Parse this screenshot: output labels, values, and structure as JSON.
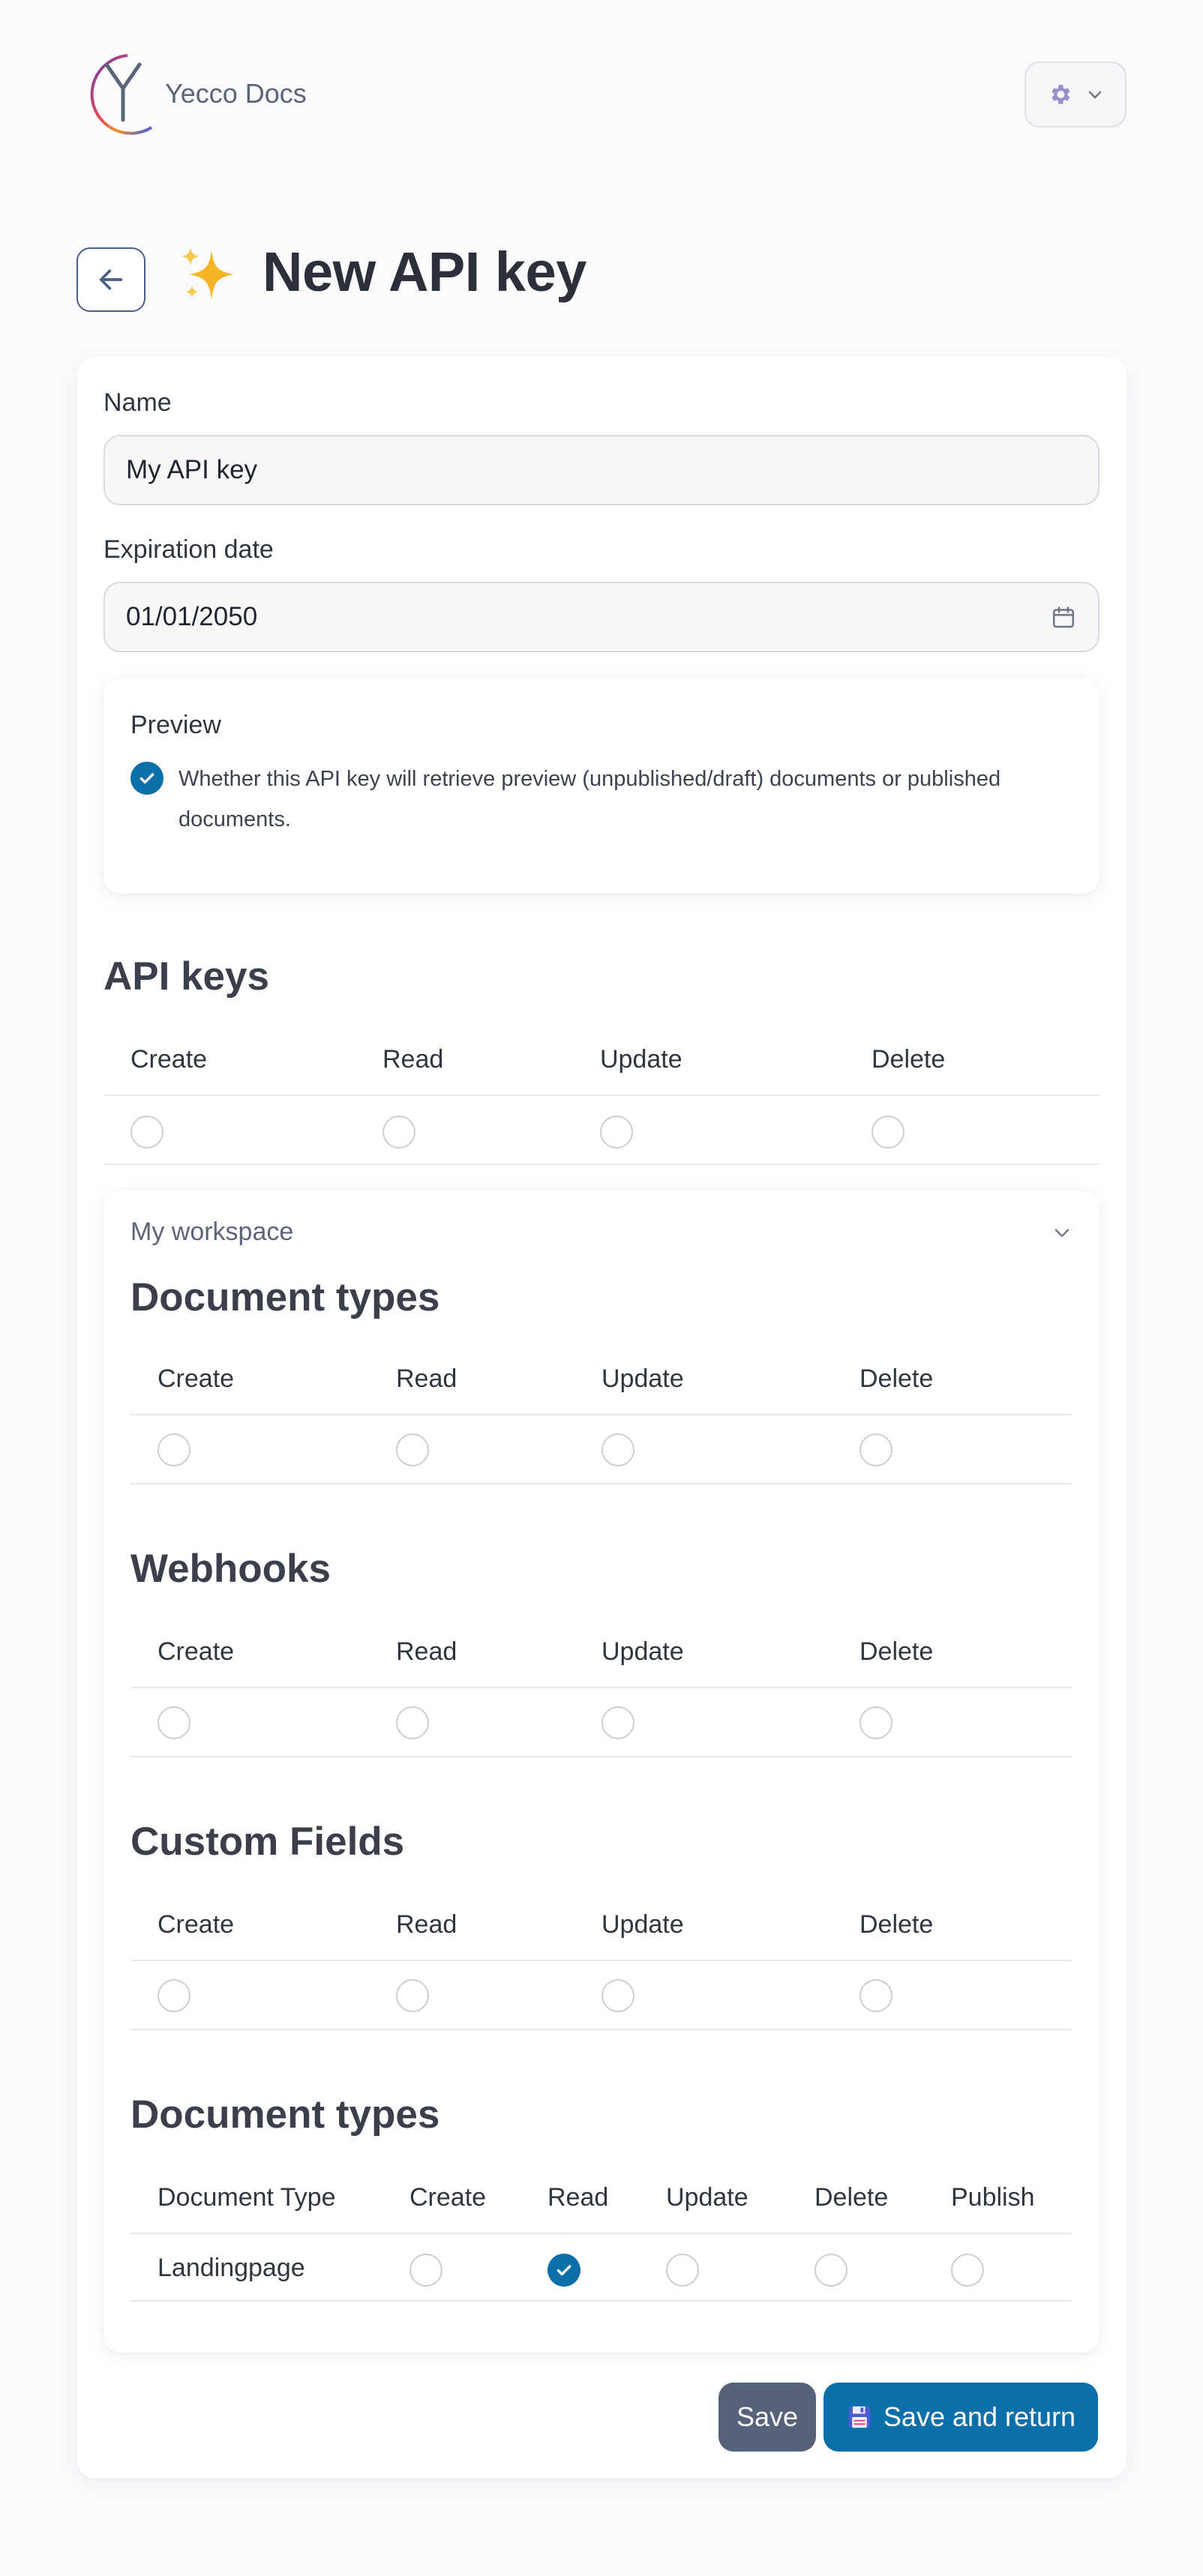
{
  "header": {
    "brand_name": "Yecco Docs",
    "logo_letter": "Y",
    "settings_icon": "gear-icon"
  },
  "page": {
    "title": "New API key",
    "title_emoji": "✨"
  },
  "form": {
    "name_label": "Name",
    "name_value": "My API key",
    "expiration_label": "Expiration date",
    "expiration_value": "01/01/2050",
    "preview": {
      "title": "Preview",
      "checked": true,
      "description": "Whether this API key will retrieve preview (unpublished/draft) documents or published documents."
    }
  },
  "api_keys": {
    "title": "API keys",
    "columns": [
      "Create",
      "Read",
      "Update",
      "Delete"
    ],
    "values": [
      false,
      false,
      false,
      false
    ]
  },
  "workspace": {
    "name": "My workspace",
    "sections": [
      {
        "title": "Document types",
        "columns": [
          "Create",
          "Read",
          "Update",
          "Delete"
        ],
        "values": [
          false,
          false,
          false,
          false
        ]
      },
      {
        "title": "Webhooks",
        "columns": [
          "Create",
          "Read",
          "Update",
          "Delete"
        ],
        "values": [
          false,
          false,
          false,
          false
        ]
      },
      {
        "title": "Custom Fields",
        "columns": [
          "Create",
          "Read",
          "Update",
          "Delete"
        ],
        "values": [
          false,
          false,
          false,
          false
        ]
      }
    ],
    "doc_type_permissions": {
      "title": "Document types",
      "columns": [
        "Document Type",
        "Create",
        "Read",
        "Update",
        "Delete",
        "Publish"
      ],
      "rows": [
        {
          "name": "Landingpage",
          "values": [
            false,
            true,
            false,
            false,
            false
          ]
        }
      ]
    }
  },
  "actions": {
    "save_label": "Save",
    "save_return_label": "Save and return",
    "save_return_icon": "💾"
  },
  "colors": {
    "accent": "#0b6fa9",
    "secondary_button": "#56617a",
    "title_text": "#2b303b"
  }
}
